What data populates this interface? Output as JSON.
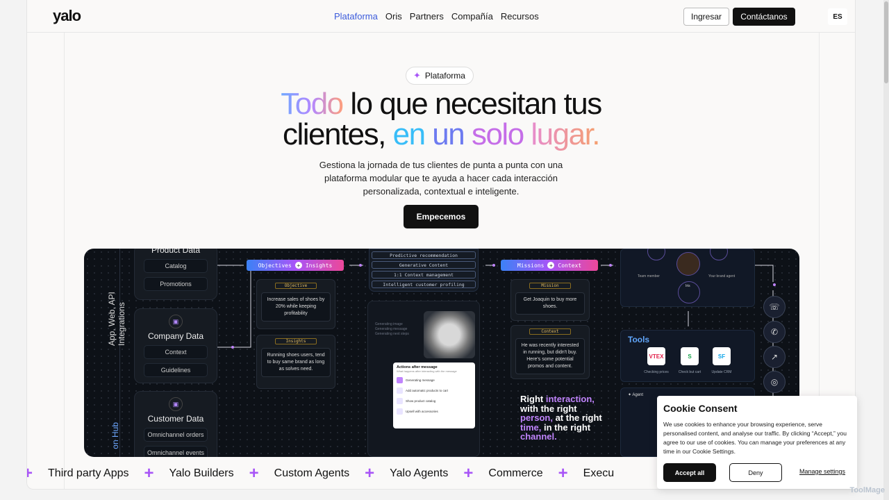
{
  "header": {
    "logo": "yalo",
    "nav": [
      "Plataforma",
      "Oris",
      "Partners",
      "Compañía",
      "Recursos"
    ],
    "login": "Ingresar",
    "contact": "Contáctanos",
    "lang": "ES"
  },
  "hero": {
    "pill": "Plataforma",
    "title_line1_grad": "Todo",
    "title_line1_rest": " lo que necesitan tus",
    "title_line2_a": "clientes, ",
    "title_line2_en": "en",
    "title_line2_un": " un",
    "title_line2_solo": " solo",
    "title_line2_lugar": " lugar.",
    "subtitle": "Gestiona la jornada de tus clientes de punta a punta con una plataforma modular que te ayuda a hacer cada interacción personalizada, contextual e inteligente.",
    "cta": "Empecemos"
  },
  "panel": {
    "vertical_label": "App, Web, API Integrations",
    "vertical_label2": "on Hub",
    "product": {
      "title": "Product Data",
      "items": [
        "Catalog",
        "Promotions"
      ]
    },
    "company": {
      "title": "Company Data",
      "items": [
        "Context",
        "Guidelines"
      ]
    },
    "customer": {
      "title": "Customer Data",
      "items": [
        "Omnichannel orders",
        "Omnichannel events"
      ]
    },
    "tag_objectives": [
      "Objectives",
      "Insights"
    ],
    "tag_missions": [
      "Missions",
      "Context"
    ],
    "objective": {
      "label": "Objective",
      "text": "Increase sales of shoes by 20% while keeping profitability"
    },
    "insights": {
      "label": "Insights",
      "text": "Running shoes users, tend to buy same brand as long as solves need."
    },
    "mission": {
      "label": "Mission",
      "text": "Get Joaquin to buy more shoes."
    },
    "context": {
      "label": "Context",
      "text": "He was recently interested in running, but didn't buy. Here's some potential promos and content."
    },
    "stack": [
      "Predictive recommendation",
      "Generative Content",
      "1:1 Context management",
      "Intelligent customer profiling"
    ],
    "gen_text": [
      "Generating image",
      "Generating message",
      "Generating next steps"
    ],
    "actions": {
      "title": "Actions after message",
      "subtitle": "What happens after interacting with the message",
      "rows": [
        "Generating message",
        "Add automatic products to cart",
        "Show product catalog",
        "Upsell with accessories"
      ]
    },
    "right_text": [
      "Right ",
      "interaction,",
      " with the right ",
      "person,",
      " at the right ",
      "time,",
      " in the right ",
      "channel."
    ],
    "team": {
      "member": "Team member",
      "agent": "Your brand agent",
      "iris": "Iris"
    },
    "tools": {
      "title": "Tools",
      "labels": [
        "Checking prices",
        "Check but cart",
        "Update CRM"
      ],
      "logos": [
        "VTEX",
        "S",
        "SF"
      ]
    },
    "agent_label": "Agent",
    "side_icons": [
      "whatsapp-icon",
      "phone-icon",
      "chart-icon",
      "instagram-icon"
    ]
  },
  "marquee": [
    "Third party Apps",
    "Yalo Builders",
    "Custom Agents",
    "Yalo Agents",
    "Commerce",
    "Execu"
  ],
  "cookie": {
    "title": "Cookie Consent",
    "text": "We use cookies to enhance your browsing experience, serve personalised content, and analyse our traffic. By clicking “Accept,” you agree to our use of cookies. You can manage your preferences at any time in our Cookie Settings.",
    "accept": "Accept all",
    "deny": "Deny",
    "manage": "Manage settings"
  },
  "watermark": "ToolMage",
  "colors": {
    "accent": "#3b5bdb",
    "purple": "#a855f7",
    "dark": "#0d1117"
  }
}
